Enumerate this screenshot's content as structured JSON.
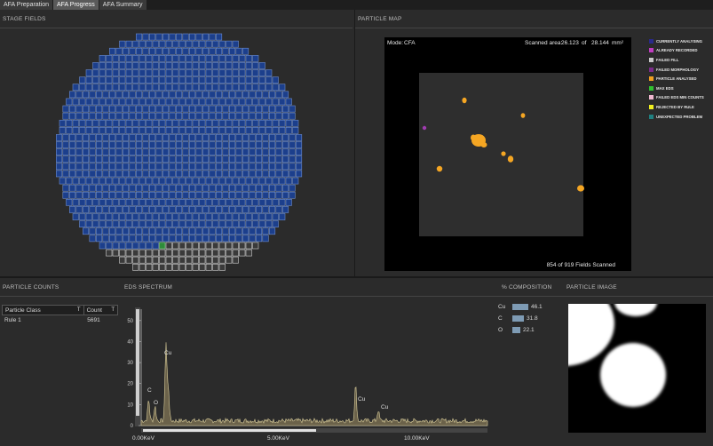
{
  "tabs": [
    {
      "label": "AFA Preparation",
      "active": false
    },
    {
      "label": "AFA Progress",
      "active": true
    },
    {
      "label": "AFA Summary",
      "active": false
    }
  ],
  "stage_fields": {
    "title": "STAGE FIELDS"
  },
  "particle_map": {
    "title": "PARTICLE MAP",
    "mode_label": "Mode:",
    "mode_value": "CFA",
    "scanned_area_label": "Scanned area:",
    "scanned_area_value": "26.123",
    "of_label": "of",
    "total_area": "28.144",
    "area_unit": "mm²",
    "fields_scanned": "854 of 919 Fields Scanned",
    "legend": [
      {
        "label": "CURRENTLY ANALYSING",
        "color": "#2a2a8a"
      },
      {
        "label": "ALREADY RECORDED",
        "color": "#c03cc0"
      },
      {
        "label": "FAILED FILL",
        "color": "#c8c8c8"
      },
      {
        "label": "FAILED MORPHOLOGY",
        "color": "#7a2a8a"
      },
      {
        "label": "PARTICLE ANALYSED",
        "color": "#f0a020"
      },
      {
        "label": "MAX EDS",
        "color": "#30c030"
      },
      {
        "label": "FAILED EDS MIN COUNTS",
        "color": "#f0b8d0"
      },
      {
        "label": "REJECTED BY RULE",
        "color": "#f0f020"
      },
      {
        "label": "UNEXPECTED PROBLEM",
        "color": "#208080"
      }
    ]
  },
  "particle_counts": {
    "title": "PARTICLE COUNTS",
    "col_class": "Particle Class",
    "col_count": "Count",
    "filter_glyph": "T",
    "rows": [
      {
        "class": "Rule 1",
        "count": "5691"
      }
    ]
  },
  "eds": {
    "title": "EDS SPECTRUM",
    "y_ticks": [
      "50",
      "40",
      "30",
      "20",
      "10",
      "0"
    ],
    "x_ticks": [
      "0.00KeV",
      "5.00KeV",
      "10.00KeV"
    ],
    "peak_labels": [
      "C",
      "O",
      "Cu",
      "Cu",
      "Cu"
    ]
  },
  "composition": {
    "title": "% COMPOSITION",
    "rows": [
      {
        "element": "Cu",
        "value": "46.1",
        "pct": 46.1
      },
      {
        "element": "C",
        "value": "31.8",
        "pct": 31.8
      },
      {
        "element": "O",
        "value": "22.1",
        "pct": 22.1
      }
    ]
  },
  "particle_image": {
    "title": "PARTICLE IMAGE"
  },
  "colors": {
    "field_blue": "#1c3f8c",
    "field_empty": "#3a3a3a",
    "field_current": "#2e8b3a",
    "particle": "#f5a623"
  }
}
